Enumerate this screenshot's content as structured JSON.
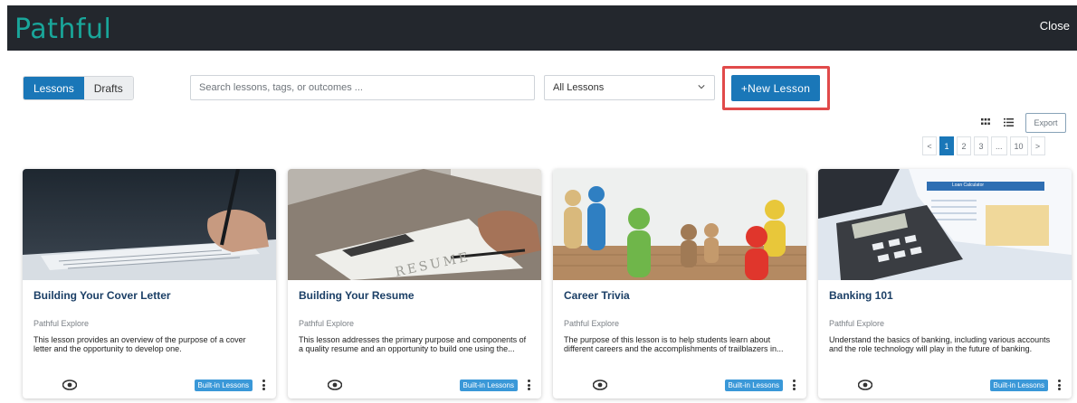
{
  "app": {
    "logo_text": "Pathful",
    "close_label": "Close",
    "brand_color": "#19a69a",
    "accent_color": "#1a77b8"
  },
  "toolbar": {
    "tabs": [
      {
        "label": "Lessons",
        "active": true
      },
      {
        "label": "Drafts",
        "active": false
      }
    ],
    "search": {
      "placeholder": "Search lessons, tags, or outcomes ...",
      "value": ""
    },
    "filter": {
      "selected": "All Lessons",
      "icon": "chevron-down-icon"
    },
    "new_button_label": "+New Lesson",
    "export_label": "Export",
    "view_icons": [
      "grid-view-icon",
      "list-view-icon"
    ]
  },
  "pagination": {
    "prev": "<",
    "pages": [
      "1",
      "2",
      "3",
      "...",
      "10"
    ],
    "next": ">",
    "current": "1"
  },
  "cards": [
    {
      "title": "Building Your Cover Letter",
      "source": "Pathful Explore",
      "description": "This lesson provides an overview of the purpose of a cover letter and the opportunity to develop one.",
      "badge": "Built-in Lessons",
      "image": "hand-writing-letter-photo"
    },
    {
      "title": "Building Your Resume",
      "source": "Pathful Explore",
      "description": "This lesson addresses the primary purpose and components of a quality resume and an opportunity to build one using the...",
      "badge": "Built-in Lessons",
      "image": "resume-clipboard-photo",
      "image_text": "RESUME"
    },
    {
      "title": "Career Trivia",
      "source": "Pathful Explore",
      "description": "The purpose of this lesson is to help students learn about different careers and the accomplishments of trailblazers in...",
      "badge": "Built-in Lessons",
      "image": "wooden-figures-photo"
    },
    {
      "title": "Banking 101",
      "source": "Pathful Explore",
      "description": "Understand the basics of banking, including various accounts and the role technology will play in the future of banking.",
      "badge": "Built-in Lessons",
      "image": "calculator-loan-photo",
      "image_text": "Loan Calculator"
    }
  ]
}
